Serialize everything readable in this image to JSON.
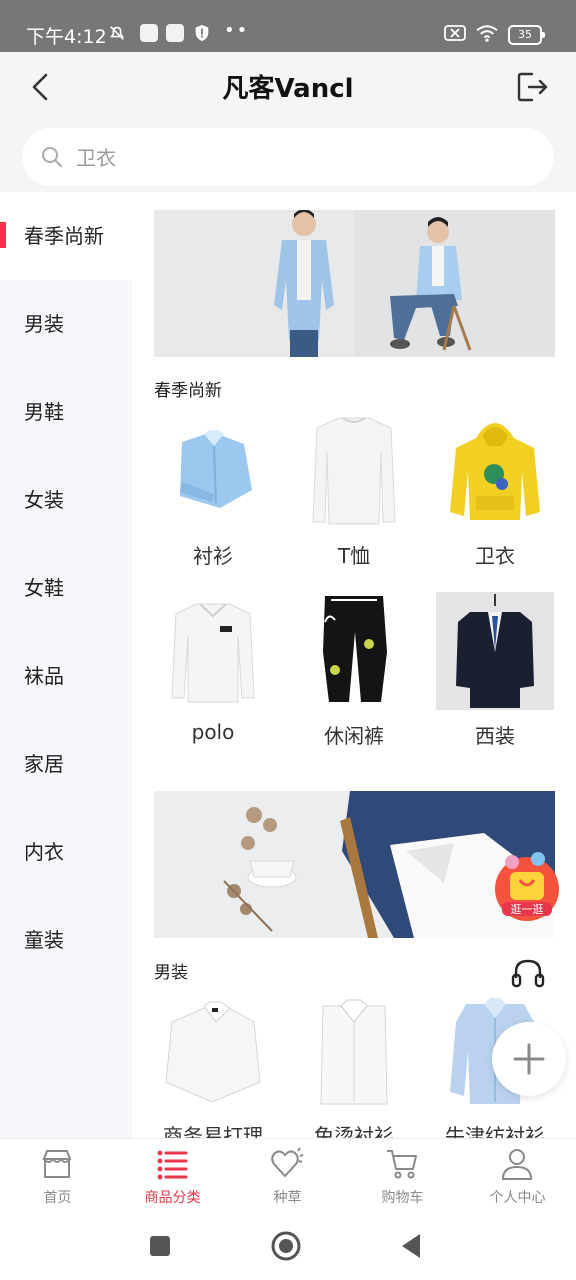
{
  "status_bar": {
    "time": "下午4:12",
    "battery": "35"
  },
  "header": {
    "title": "凡客Vancl"
  },
  "search": {
    "placeholder": "卫衣"
  },
  "sidebar": {
    "items": [
      {
        "label": "春季尚新",
        "active": true
      },
      {
        "label": "男装"
      },
      {
        "label": "男鞋"
      },
      {
        "label": "女装"
      },
      {
        "label": "女鞋"
      },
      {
        "label": "袜品"
      },
      {
        "label": "家居"
      },
      {
        "label": "内衣"
      },
      {
        "label": "童装"
      }
    ]
  },
  "sections": [
    {
      "title": "春季尚新",
      "products": [
        {
          "label": "衬衫",
          "icon": "blue-shirt"
        },
        {
          "label": "T恤",
          "icon": "white-longsleeve"
        },
        {
          "label": "卫衣",
          "icon": "yellow-hoodie"
        },
        {
          "label": "polo",
          "icon": "white-polo"
        },
        {
          "label": "休闲裤",
          "icon": "black-joggers"
        },
        {
          "label": "西装",
          "icon": "navy-suit"
        }
      ]
    },
    {
      "title": "男装",
      "products": [
        {
          "label": "商务易打理",
          "icon": "white-shirt-folded"
        },
        {
          "label": "免烫衬衫",
          "icon": "white-shirt"
        },
        {
          "label": "牛津纺衬衫",
          "icon": "light-blue-shirt"
        }
      ]
    }
  ],
  "floating": {
    "badge_label": "逛一逛"
  },
  "bottom_nav": {
    "items": [
      {
        "label": "首页",
        "icon": "store-icon"
      },
      {
        "label": "商品分类",
        "icon": "list-icon",
        "active": true
      },
      {
        "label": "种草",
        "icon": "heart-icon"
      },
      {
        "label": "购物车",
        "icon": "cart-icon"
      },
      {
        "label": "个人中心",
        "icon": "person-icon"
      }
    ]
  },
  "colors": {
    "accent": "#e8364b",
    "sidebar_bg": "#f6f7fa",
    "status_bar": "#777777"
  }
}
